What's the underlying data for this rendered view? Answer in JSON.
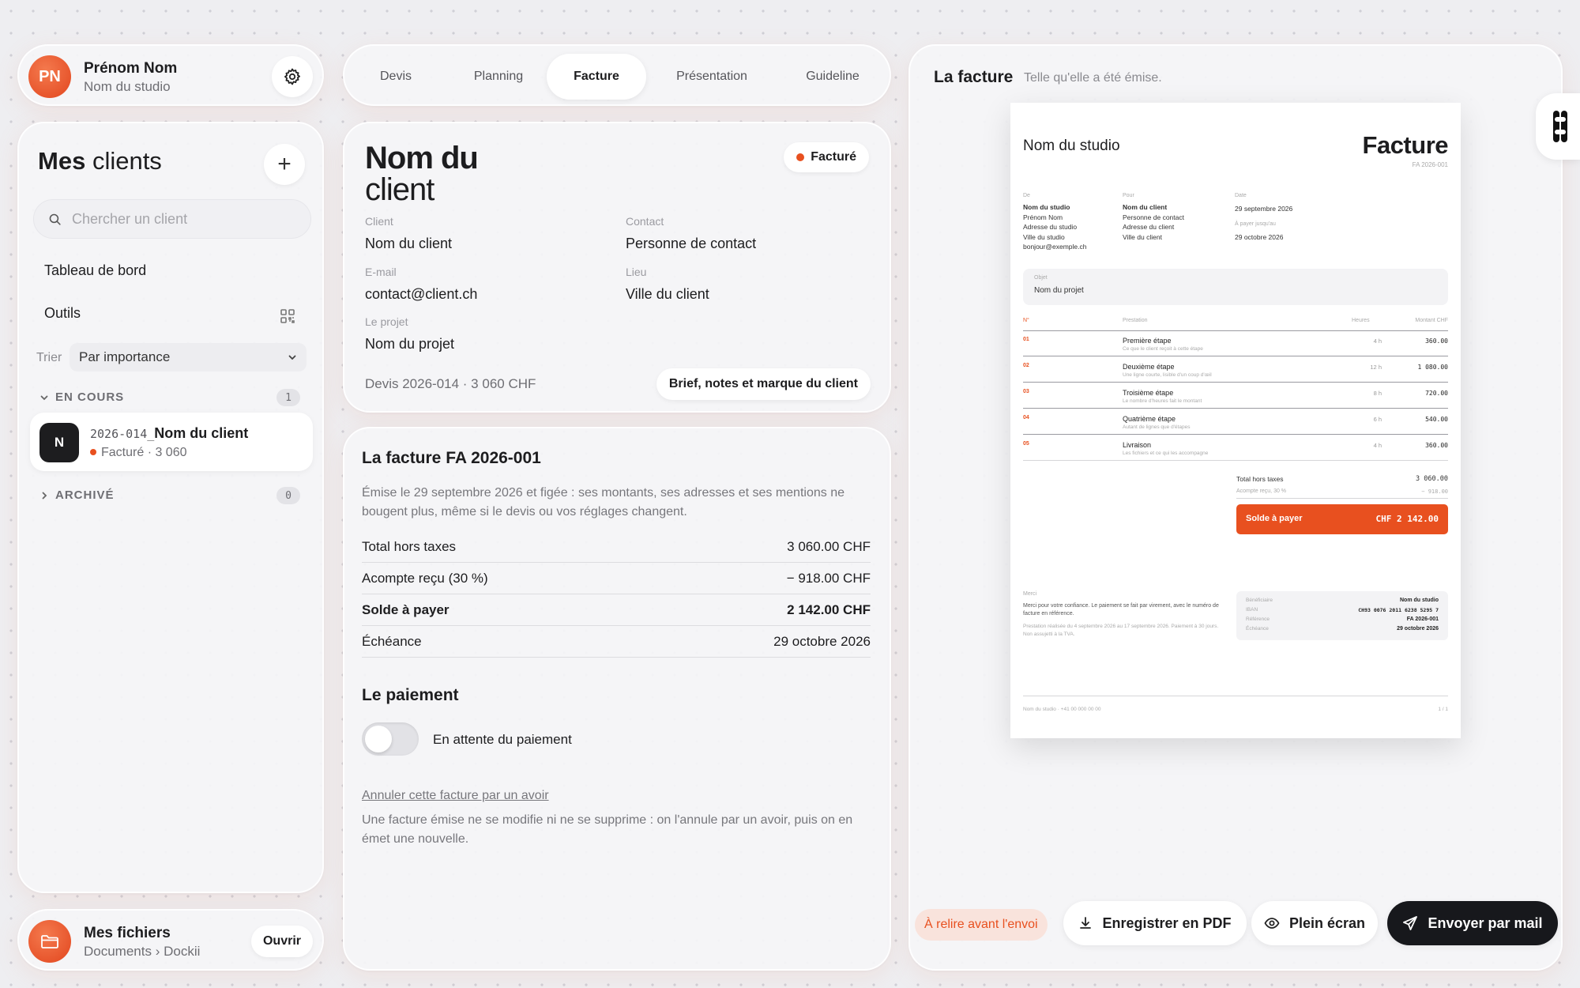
{
  "user": {
    "initials": "PN",
    "name": "Prénom Nom",
    "studio": "Nom du studio"
  },
  "clients": {
    "title_bold": "Mes",
    "title_rest": "clients",
    "search_placeholder": "Chercher un client",
    "nav": [
      "Tableau de bord",
      "Outils"
    ],
    "sort_label": "Trier",
    "sort_value": "Par importance",
    "groups": [
      {
        "label": "EN COURS",
        "count": "1"
      },
      {
        "label": "ARCHIVÉ",
        "count": "0"
      }
    ],
    "items": [
      {
        "initial": "N",
        "code": "2026-014_",
        "name": "Nom du client",
        "status": "Facturé · 3 060"
      }
    ]
  },
  "files": {
    "title": "Mes fichiers",
    "path": "Documents › Dockii",
    "open_label": "Ouvrir"
  },
  "tabs": [
    {
      "label": "Devis",
      "active": false
    },
    {
      "label": "Planning",
      "active": false
    },
    {
      "label": "Facture",
      "active": true
    },
    {
      "label": "Présentation",
      "active": false
    },
    {
      "label": "Guideline",
      "active": false
    }
  ],
  "client_card": {
    "name_line1": "Nom du",
    "name_line2": "client",
    "status": "Facturé",
    "fields": {
      "client_label": "Client",
      "client_value": "Nom du client",
      "contact_label": "Contact",
      "contact_value": "Personne de contact",
      "email_label": "E-mail",
      "email_value": "contact@client.ch",
      "place_label": "Lieu",
      "place_value": "Ville du client",
      "project_label": "Le projet",
      "project_value": "Nom du projet"
    },
    "devis_line": "Devis 2026-014 · 3 060 CHF",
    "brief_button": "Brief, notes et marque du client"
  },
  "invoice": {
    "title": "La facture FA 2026-001",
    "description": "Émise le 29 septembre 2026 et figée : ses montants, ses adresses et ses mentions ne bougent plus, même si le devis ou vos réglages changent.",
    "rows": [
      {
        "label": "Total hors taxes",
        "value": "3 060.00 CHF",
        "bold": false
      },
      {
        "label": "Acompte reçu (30 %)",
        "value": "− 918.00 CHF",
        "bold": false
      },
      {
        "label": "Solde à payer",
        "value": "2 142.00 CHF",
        "bold": true
      },
      {
        "label": "Échéance",
        "value": "29 octobre 2026",
        "bold": false
      }
    ],
    "payment_title": "Le paiement",
    "payment_toggle_label": "En attente du paiement",
    "cancel_link": "Annuler cette facture par un avoir",
    "cancel_note": "Une facture émise ne se modifie ni ne se supprime : on l'annule par un avoir, puis on en émet une nouvelle."
  },
  "preview": {
    "title": "La facture",
    "subtitle": "Telle qu'elle a été émise.",
    "doc": {
      "studio": "Nom du studio",
      "heading": "Facture",
      "number": "FA 2026-001",
      "from_label": "De",
      "from_lines": [
        "Nom du studio",
        "Prénom Nom",
        "Adresse du studio",
        "Ville du studio",
        "bonjour@exemple.ch"
      ],
      "to_label": "Pour",
      "to_lines": [
        "Nom du client",
        "Personne de contact",
        "Adresse du client",
        "Ville du client"
      ],
      "date_label": "Date",
      "date_value": "29 septembre 2026",
      "due_label": "À payer jusqu'au",
      "due_value": "29 octobre 2026",
      "object_label": "Objet",
      "object_value": "Nom du projet",
      "col_num": "N°",
      "col_service": "Prestation",
      "col_hours": "Heures",
      "col_amount": "Montant CHF",
      "lines": [
        {
          "n": "01",
          "title": "Première étape",
          "sub": "Ce que le client reçoit à cette étape",
          "hours": "4 h",
          "amount": "360.00"
        },
        {
          "n": "02",
          "title": "Deuxième étape",
          "sub": "Une ligne courte, lisible d'un coup d'œil",
          "hours": "12 h",
          "amount": "1 080.00"
        },
        {
          "n": "03",
          "title": "Troisième étape",
          "sub": "Le nombre d'heures fait le montant",
          "hours": "8 h",
          "amount": "720.00"
        },
        {
          "n": "04",
          "title": "Quatrième étape",
          "sub": "Autant de lignes que d'étapes",
          "hours": "6 h",
          "amount": "540.00"
        },
        {
          "n": "05",
          "title": "Livraison",
          "sub": "Les fichiers et ce qui les accompagne",
          "hours": "4 h",
          "amount": "360.00"
        }
      ],
      "total_label": "Total hors taxes",
      "total_value": "3 060.00",
      "deposit_label": "Acompte reçu, 30 %",
      "deposit_value": "− 918.00",
      "balance_label": "Solde à payer",
      "balance_value": "CHF 2 142.00",
      "thanks_label": "Merci",
      "thanks_text": "Merci pour votre confiance. Le paiement se fait par virement, avec le numéro de facture en référence.",
      "legal_text": "Prestation réalisée du 4 septembre 2026 au 17 septembre 2026. Paiement à 30 jours. Non assujetti à la TVA.",
      "bank_rows": [
        {
          "k": "Bénéficiaire",
          "v": "Nom du studio"
        },
        {
          "k": "IBAN",
          "v": "CH93 0076 2011 6238 5295 7"
        },
        {
          "k": "Référence",
          "v": "FA 2026-001"
        },
        {
          "k": "Échéance",
          "v": "29 octobre 2026"
        }
      ],
      "footer_left": "Nom du studio · +41 00 000 00 00",
      "footer_right": "1 / 1"
    }
  },
  "actions": {
    "review_badge": "À relire avant l'envoi",
    "save_pdf": "Enregistrer en PDF",
    "fullscreen": "Plein écran",
    "send_mail": "Envoyer par mail"
  },
  "colors": {
    "accent": "#e8501f",
    "dark": "#17181c"
  }
}
